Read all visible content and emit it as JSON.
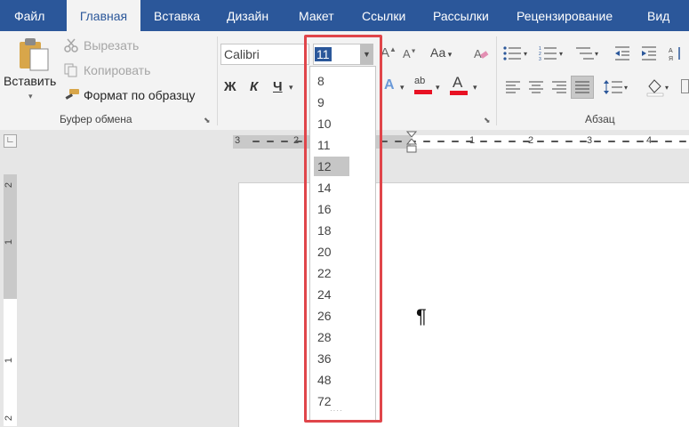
{
  "tabs": [
    {
      "label": "Файл"
    },
    {
      "label": "Главная"
    },
    {
      "label": "Вставка"
    },
    {
      "label": "Дизайн"
    },
    {
      "label": "Макет"
    },
    {
      "label": "Ссылки"
    },
    {
      "label": "Рассылки"
    },
    {
      "label": "Рецензирование"
    },
    {
      "label": "Вид"
    }
  ],
  "clipboard": {
    "paste_label": "Вставить",
    "cut_label": "Вырезать",
    "copy_label": "Копировать",
    "format_painter_label": "Формат по образцу",
    "group_label": "Буфер обмена"
  },
  "font": {
    "font_name": "Calibri",
    "font_size": "11",
    "bold_glyph": "Ж",
    "italic_glyph": "К",
    "underline_glyph": "Ч",
    "change_case_glyph": "Аа",
    "highlight_glyph": "ab",
    "font_color_glyph": "А"
  },
  "paragraph": {
    "group_label": "Абзац"
  },
  "size_options": [
    "8",
    "9",
    "10",
    "11",
    "12",
    "14",
    "16",
    "18",
    "20",
    "22",
    "24",
    "26",
    "28",
    "36",
    "48",
    "72"
  ],
  "hovered_size": "12",
  "ruler": {
    "horizontal": [
      "3",
      "2",
      "1",
      "1",
      "2",
      "3",
      "4"
    ],
    "vertical": [
      "2",
      "1",
      "1",
      "2"
    ]
  },
  "document": {
    "pilcrow": "¶"
  },
  "colors": {
    "tabbar": "#2b579a",
    "highlight_border": "#e0454a",
    "hovered_option": "#c6c6c6",
    "font_color_bar": "#e81123"
  }
}
